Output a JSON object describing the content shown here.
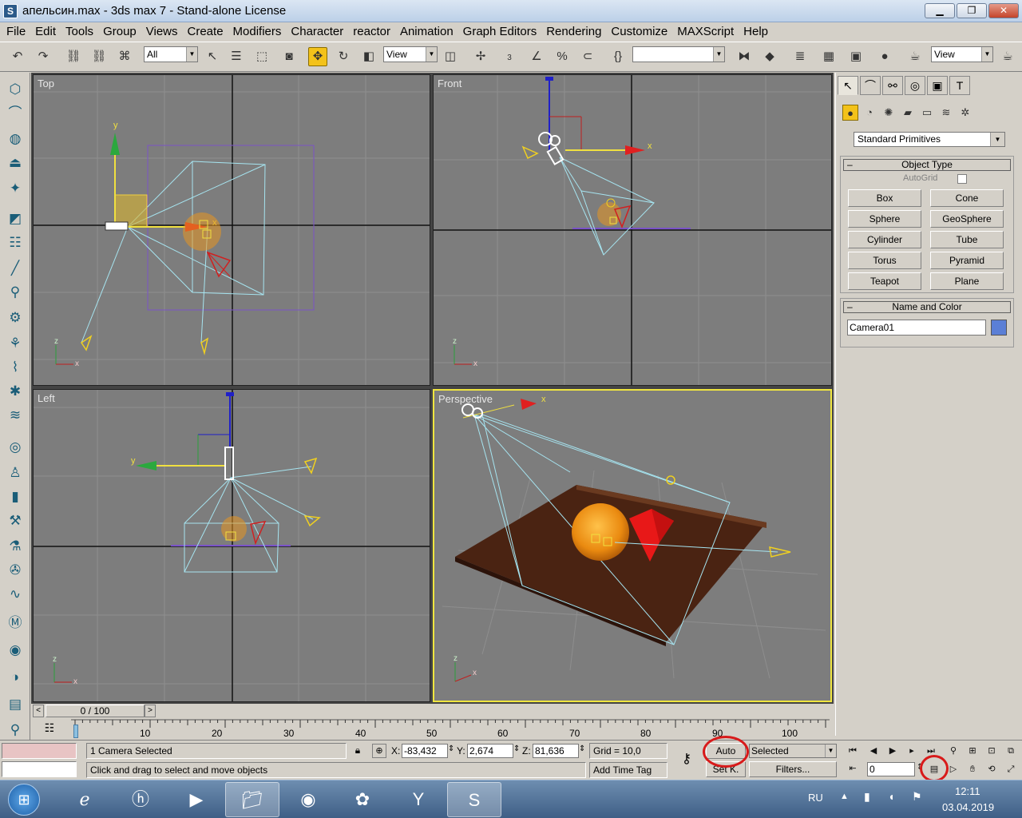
{
  "window": {
    "title": "апельсин.max - 3ds max 7 - Stand-alone License",
    "minimize": "▁",
    "maximize": "❐",
    "close": "✕",
    "app_icon_glyph": "S"
  },
  "menu": [
    "File",
    "Edit",
    "Tools",
    "Group",
    "Views",
    "Create",
    "Modifiers",
    "Character",
    "reactor",
    "Animation",
    "Graph Editors",
    "Rendering",
    "Customize",
    "MAXScript",
    "Help"
  ],
  "toolbar": {
    "selection_filter": "All",
    "reference_coord": "View",
    "named_selection": "",
    "render_view": "View",
    "snap_label": "3"
  },
  "viewports": {
    "top": "Top",
    "front": "Front",
    "left": "Left",
    "perspective": "Perspective"
  },
  "axis_labels": {
    "x": "x",
    "y": "y",
    "z": "z"
  },
  "command_panel": {
    "category": "Standard Primitives",
    "object_type_title": "Object Type",
    "autogrid": "AutoGrid",
    "buttons": [
      "Box",
      "Cone",
      "Sphere",
      "GeoSphere",
      "Cylinder",
      "Tube",
      "Torus",
      "Pyramid",
      "Teapot",
      "Plane"
    ],
    "name_color_title": "Name and Color",
    "object_name": "Camera01",
    "object_color": "#5b7fd6",
    "rollout_toggle": "–"
  },
  "timeline": {
    "frame_display": "0 / 100",
    "ticks": [
      "10",
      "20",
      "30",
      "40",
      "50",
      "60",
      "70",
      "80",
      "90",
      "100"
    ]
  },
  "status": {
    "selection": "1 Camera Selected",
    "prompt": "Click and drag to select and move objects",
    "x_label": "X:",
    "x_value": "-83,432",
    "y_label": "Y:",
    "y_value": "2,674",
    "z_label": "Z:",
    "z_value": "81,636",
    "grid": "Grid = 10,0",
    "add_time_tag": "Add Time Tag",
    "auto_key": "Auto",
    "set_key": "Set K.",
    "key_mode": "Selected",
    "filters": "Filters...",
    "current_frame": "0"
  },
  "taskbar": {
    "language": "RU",
    "time": "12:11",
    "date": "03.04.2019"
  },
  "colors": {
    "highlight_circle": "#d81a1a",
    "active_viewport": "#f0e640",
    "active_tool": "#f3c21a"
  }
}
